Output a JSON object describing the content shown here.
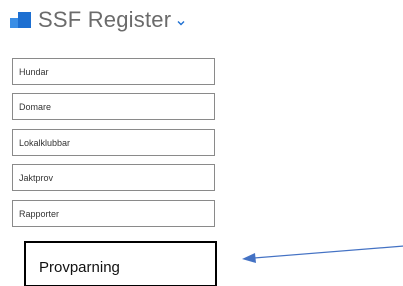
{
  "header": {
    "title": "SSF Register",
    "logo_icon": "app-logo-icon",
    "chevron_icon": "chevron-down-icon",
    "accent_color": "#1d6fd1"
  },
  "menu": {
    "items": [
      {
        "label": "Hundar"
      },
      {
        "label": "Domare"
      },
      {
        "label": "Lokalklubbar"
      },
      {
        "label": "Jaktprov"
      },
      {
        "label": "Rapporter"
      }
    ]
  },
  "highlighted_item": {
    "label": "Provparning"
  },
  "annotation": {
    "arrow_icon": "arrow-left-icon",
    "arrow_color": "#4472c4"
  }
}
